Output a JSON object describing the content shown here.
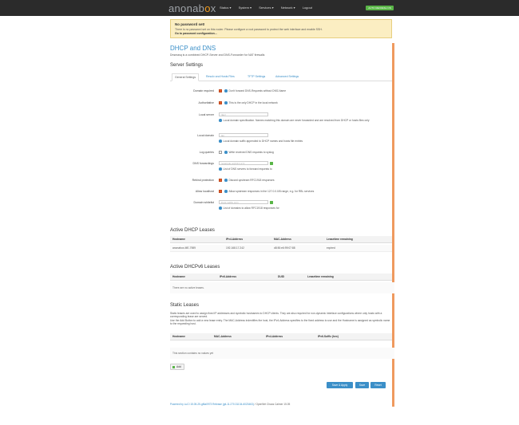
{
  "navbar": {
    "brand_main": "anonab",
    "brand_accent": "o",
    "brand_tail": "x",
    "menu": [
      "Status ▾",
      "System ▾",
      "Services ▾",
      "Network ▾",
      "Logout"
    ],
    "autorefresh": "AUTO REFRESH ON"
  },
  "alert": {
    "title": "No password set!",
    "message": "There is no password set on this router. Please configure a root password to protect the web interface and enable SSH.",
    "link": "Go to password configuration..."
  },
  "page": {
    "title": "DHCP and DNS",
    "description": "Dnsmasq is a combined DHCP-Server and DNS-Forwarder for NAT firewalls"
  },
  "server_settings": {
    "heading": "Server Settings",
    "tabs": [
      "General Settings",
      "Resolv and Hosts Files",
      "TFTP Settings",
      "Advanced Settings"
    ],
    "fields": {
      "domain_required": {
        "label": "Domain required",
        "help": "Don't forward DNS-Requests without DNS-Name"
      },
      "authoritative": {
        "label": "Authoritative",
        "help": "This is the only DHCP in the local network"
      },
      "local_server": {
        "label": "Local server",
        "value": "/lan/",
        "help": "Local domain specification. Names matching this domain are never forwarded and are resolved from DHCP or hosts files only"
      },
      "local_domain": {
        "label": "Local domain",
        "value": "lan",
        "help": "Local domain suffix appended to DHCP names and hosts file entries"
      },
      "log_queries": {
        "label": "Log queries",
        "help": "Write received DNS requests to syslog"
      },
      "dns_forwardings": {
        "label": "DNS forwardings",
        "placeholder": "/example.org/10.1.2.3",
        "help": "List of DNS servers to forward requests to"
      },
      "rebind_protection": {
        "label": "Rebind protection",
        "help": "Discard upstream RFC1918 responses"
      },
      "allow_localhost": {
        "label": "Allow localhost",
        "help": "Allow upstream responses in the 127.0.0.0/8 range, e.g. for RBL services"
      },
      "domain_whitelist": {
        "label": "Domain whitelist",
        "placeholder": "ihost.netflix.com",
        "help": "List of domains to allow RFC1918 responses for"
      }
    }
  },
  "dhcp_leases": {
    "heading": "Active DHCP Leases",
    "columns": [
      "Hostname",
      "IPv4-Address",
      "MAC-Address",
      "Leasetime remaining"
    ],
    "rows": [
      [
        "anonabox-ME-7989",
        "192.168.17.242",
        "d8:50:e6:99:07:88",
        "expired"
      ]
    ]
  },
  "dhcpv6_leases": {
    "heading": "Active DHCPv6 Leases",
    "columns": [
      "Hostname",
      "IPv6-Address",
      "DUID",
      "Leasetime remaining"
    ],
    "empty": "There are no active leases."
  },
  "static_leases": {
    "heading": "Static Leases",
    "description": "Static leases are used to assign fixed IP addresses and symbolic hostnames to DHCP clients. They are also required for non-dynamic interface configurations where only hosts with a corresponding lease are served.",
    "description2": "Use the Add Button to add a new lease entry. The MAC-Address indentifies the host, the IPv4-Address specifies to the fixed address to use and the Hostname is assigned as symbolic name to the requesting host.",
    "columns": [
      "Hostname",
      "MAC-Address",
      "IPv4-Address",
      "IPv6-Suffix (hex)"
    ],
    "empty": "This section contains no values yet",
    "add_label": "Add"
  },
  "actions": {
    "save_apply": "Save & Apply",
    "save": "Save",
    "reset": "Reset"
  },
  "footer": {
    "link": "Powered by LuCI 15.05-25-gf6a0973 Release (git-11.270.31134-6023463)",
    "text": " / OpenWrt Chaos Calmer 15.05"
  }
}
